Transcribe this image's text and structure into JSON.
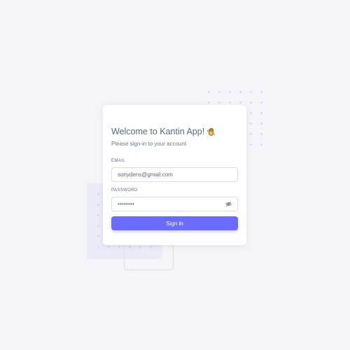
{
  "login_card": {
    "title": "Welcome to Kantin App!",
    "title_emoji_icon": "waving-hand-icon",
    "subtitle": "Please sign-in to your account",
    "email": {
      "label": "EMAIL",
      "value": "sonydens@gmail.com"
    },
    "password": {
      "label": "PASSWORD",
      "value": "••••••••",
      "toggle_icon": "eye-off-icon"
    },
    "signin_button": {
      "label": "Sign in"
    }
  },
  "colors": {
    "background": "#f5f5f9",
    "card": "#ffffff",
    "primary": "#696cff",
    "text_heading": "#566a7f",
    "text_body": "#697a8d",
    "input_border": "#d9dee3"
  }
}
